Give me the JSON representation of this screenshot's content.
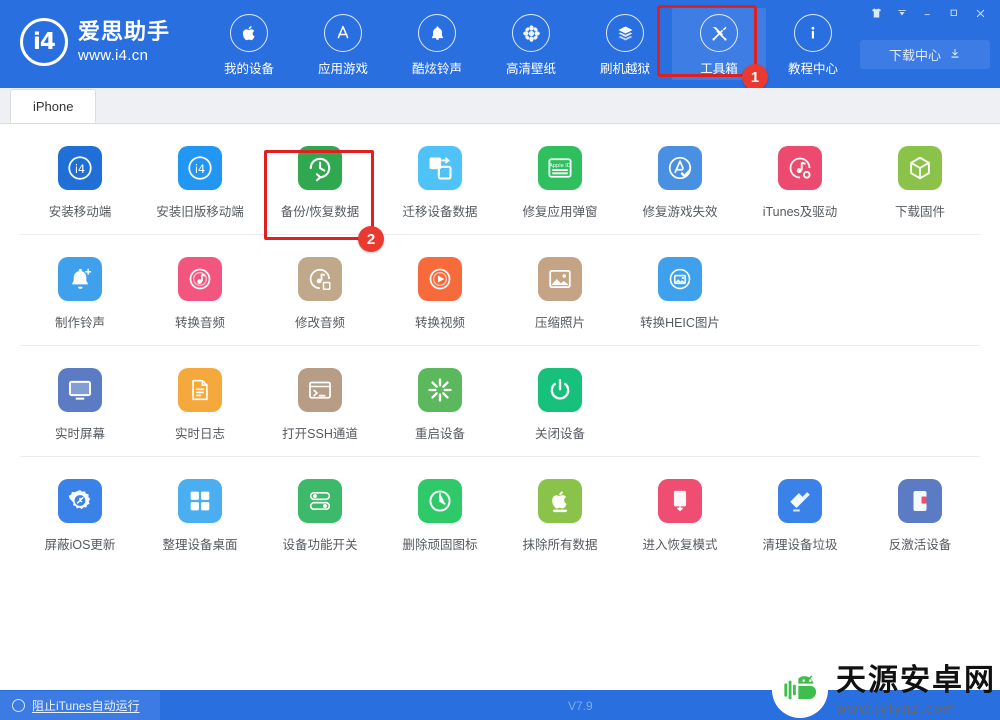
{
  "window": {
    "controls": [
      {
        "name": "skin-icon",
        "glyph": "A"
      },
      {
        "name": "menu-dropdown-icon",
        "glyph": "▼"
      },
      {
        "name": "minimize-icon",
        "glyph": "─"
      },
      {
        "name": "maximize-icon",
        "glyph": "□"
      },
      {
        "name": "close-icon",
        "glyph": "✕"
      }
    ]
  },
  "brand": {
    "mark": "i4",
    "name": "爱思助手",
    "url": "www.i4.cn"
  },
  "header": {
    "accent": "#2a6fe0",
    "download_center": "下载中心",
    "nav": [
      {
        "label": "我的设备",
        "icon": "apple-icon",
        "active": false
      },
      {
        "label": "应用游戏",
        "icon": "appstore-icon",
        "active": false
      },
      {
        "label": "酷炫铃声",
        "icon": "bell-icon",
        "active": false
      },
      {
        "label": "高清壁纸",
        "icon": "flower-icon",
        "active": false
      },
      {
        "label": "刷机越狱",
        "icon": "box-open-icon",
        "active": false
      },
      {
        "label": "工具箱",
        "icon": "tools-icon",
        "active": true
      },
      {
        "label": "教程中心",
        "icon": "info-icon",
        "active": false
      }
    ]
  },
  "tabs": [
    {
      "label": "iPhone",
      "active": true
    }
  ],
  "annotations": {
    "step1": "1",
    "step2": "2",
    "highlight_color": "#e02020",
    "badge_color": "#e83a30"
  },
  "toolbox": {
    "rows": [
      {
        "items": [
          {
            "label": "安装移动端",
            "icon": "i4-app-icon",
            "color": "#1f6fd6"
          },
          {
            "label": "安装旧版移动端",
            "icon": "i4-app-old-icon",
            "color": "#2196f3"
          },
          {
            "label": "备份/恢复数据",
            "icon": "backup-restore-icon",
            "color": "#2fa84f"
          },
          {
            "label": "迁移设备数据",
            "icon": "migrate-data-icon",
            "color": "#4fc3f7"
          },
          {
            "label": "修复应用弹窗",
            "icon": "appleid-fix-icon",
            "color": "#2fbf5f"
          },
          {
            "label": "修复游戏失效",
            "icon": "appstore-fix-icon",
            "color": "#4a90e2"
          },
          {
            "label": "iTunes及驱动",
            "icon": "itunes-driver-icon",
            "color": "#ec4a6e"
          },
          {
            "label": "下载固件",
            "icon": "firmware-box-icon",
            "color": "#8bc34a"
          }
        ]
      },
      {
        "items": [
          {
            "label": "制作铃声",
            "icon": "ringtone-make-icon",
            "color": "#3fa0ec"
          },
          {
            "label": "转换音频",
            "icon": "audio-convert-icon",
            "color": "#f2567f"
          },
          {
            "label": "修改音频",
            "icon": "audio-edit-icon",
            "color": "#bfa98a"
          },
          {
            "label": "转换视频",
            "icon": "video-convert-icon",
            "color": "#f76a3c"
          },
          {
            "label": "压缩照片",
            "icon": "photo-compress-icon",
            "color": "#c4a484"
          },
          {
            "label": "转换HEIC图片",
            "icon": "heic-convert-icon",
            "color": "#3fa0ec"
          }
        ]
      },
      {
        "items": [
          {
            "label": "实时屏幕",
            "icon": "live-screen-icon",
            "color": "#5b7cc4"
          },
          {
            "label": "实时日志",
            "icon": "live-log-icon",
            "color": "#f5a93c"
          },
          {
            "label": "打开SSH通道",
            "icon": "ssh-terminal-icon",
            "color": "#b79d86"
          },
          {
            "label": "重启设备",
            "icon": "reboot-icon",
            "color": "#5cb85c"
          },
          {
            "label": "关闭设备",
            "icon": "power-off-icon",
            "color": "#17c07b"
          }
        ]
      },
      {
        "items": [
          {
            "label": "屏蔽iOS更新",
            "icon": "block-update-icon",
            "color": "#3b82e8"
          },
          {
            "label": "整理设备桌面",
            "icon": "organize-desktop-icon",
            "color": "#4aaef0"
          },
          {
            "label": "设备功能开关",
            "icon": "feature-toggle-icon",
            "color": "#3cba6a"
          },
          {
            "label": "删除顽固图标",
            "icon": "delete-icon-icon",
            "color": "#2fc96a"
          },
          {
            "label": "抹除所有数据",
            "icon": "erase-all-icon",
            "color": "#8bc34a"
          },
          {
            "label": "进入恢复模式",
            "icon": "recovery-mode-icon",
            "color": "#ef4e72"
          },
          {
            "label": "清理设备垃圾",
            "icon": "clean-trash-icon",
            "color": "#3b82e8"
          },
          {
            "label": "反激活设备",
            "icon": "deactivate-icon",
            "color": "#5b7cc4"
          }
        ]
      }
    ]
  },
  "statusbar": {
    "block_itunes": "阻止iTunes自动运行",
    "version": "V7.9"
  },
  "watermark": {
    "title": "天源安卓网",
    "url": "www.jytyaz.com"
  }
}
